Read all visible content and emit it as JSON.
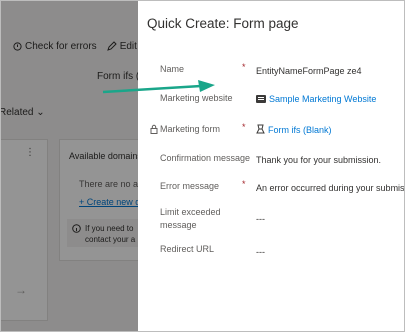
{
  "background": {
    "toolbar": {
      "check_errors": "Check for errors",
      "edit": "Edit"
    },
    "form_name": "Form ifs (B",
    "related": "Related",
    "available_domains": "Available domains",
    "no_items": "There are no av",
    "create_new": "+ Create new do",
    "info_line1": "If you need to",
    "info_line2": "contact your a"
  },
  "panel": {
    "title": "Quick Create: Form page",
    "fields": [
      {
        "label": "Name",
        "required": true,
        "value": "EntityNameFormPage ze4"
      },
      {
        "label": "Marketing website",
        "required": false,
        "value": "Sample Marketing Website"
      },
      {
        "label": "Marketing form",
        "required": true,
        "value": "Form ifs (Blank)"
      },
      {
        "label": "Confirmation message",
        "required": false,
        "value": "Thank you for your submission."
      },
      {
        "label": "Error message",
        "required": true,
        "value": "An error occurred during your submission"
      },
      {
        "label": "Limit exceeded message",
        "required": false,
        "value": "---"
      },
      {
        "label": "Redirect URL",
        "required": false,
        "value": "---"
      }
    ],
    "required_mark": "*"
  },
  "colors": {
    "link": "#0078d4",
    "required": "#a4262c",
    "arrow": "#1aa68a"
  }
}
